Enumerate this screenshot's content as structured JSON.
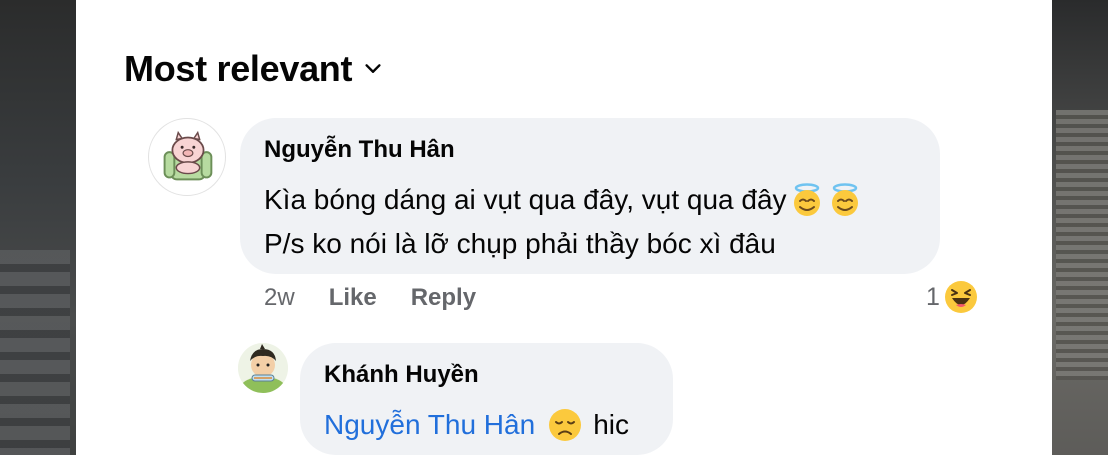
{
  "sort": {
    "label": "Most relevant",
    "icon": "chevron-down-icon"
  },
  "comment": {
    "author": "Nguyễn Thu Hân",
    "line1": "Kìa bóng dáng ai vụt qua đây, vụt qua đây",
    "line1_emojis": [
      "smiling-face-with-halo-icon",
      "smiling-face-with-halo-icon"
    ],
    "line2": "P/s ko nói là lỡ chụp phải thầy bóc xì đâu",
    "time": "2w",
    "like_label": "Like",
    "reply_label": "Reply",
    "reaction_count": "1",
    "reaction_icon": "haha-reaction-icon"
  },
  "reply": {
    "author": "Khánh Huyền",
    "mention": "Nguyễn Thu Hân",
    "emoji": "disappointed-face-icon",
    "text": "hic"
  },
  "colors": {
    "mention": "#216fdb",
    "bubble": "#f0f2f5",
    "muted": "#65676b"
  }
}
